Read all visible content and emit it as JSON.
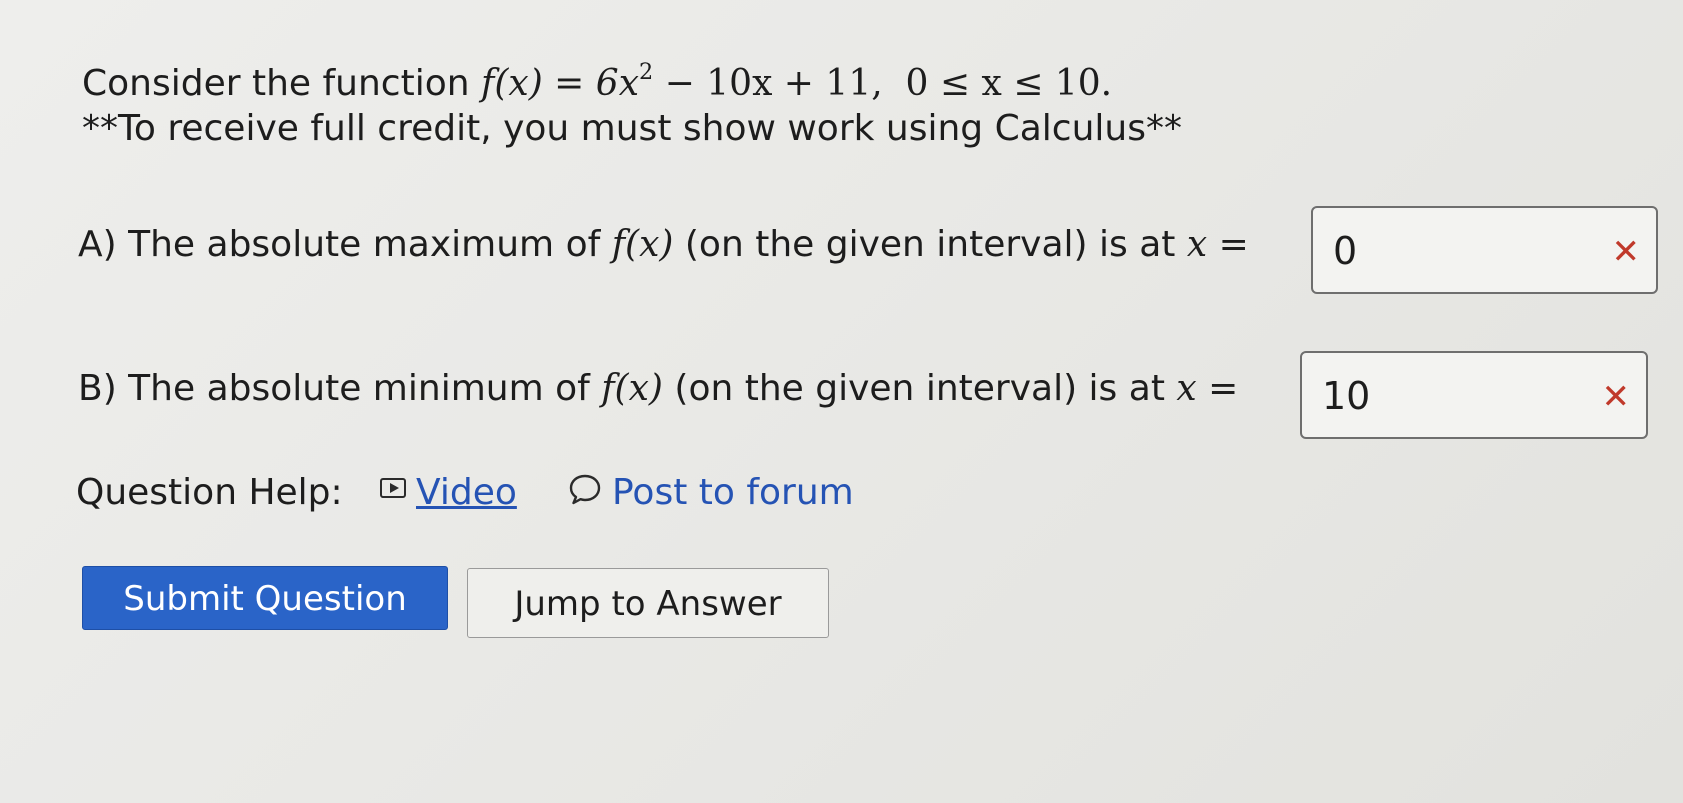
{
  "question": {
    "stem_text": "Consider the function ",
    "function_math": "f(x) = 6x",
    "exponent": "2",
    "function_rest": " − 10x + 11,  0 ≤ x ≤ 10.",
    "instruction": "**To receive full credit, you must show work using Calculus**"
  },
  "part_a": {
    "label": "A) The absolute maximum of ",
    "func": "f(x)",
    "middle": " (on the given interval) is at ",
    "var": "x",
    "equals": " =",
    "answer": "0",
    "status_icon": "incorrect-x-icon",
    "status_color": "#c0392b"
  },
  "part_b": {
    "label": "B) The absolute minimum of ",
    "func": "f(x)",
    "middle": " (on the given interval) is at ",
    "var": "x",
    "equals": " =",
    "answer": "10",
    "status_icon": "incorrect-x-icon",
    "status_color": "#c0392b"
  },
  "help": {
    "label": "Question Help:",
    "video_label": "Video",
    "video_icon": "video-play-icon",
    "forum_label": "Post to forum",
    "forum_icon": "speech-bubble-icon",
    "link_color": "#2553b4"
  },
  "buttons": {
    "submit_label": "Submit Question",
    "submit_color": "#2a64c8",
    "jump_label": "Jump to Answer"
  }
}
